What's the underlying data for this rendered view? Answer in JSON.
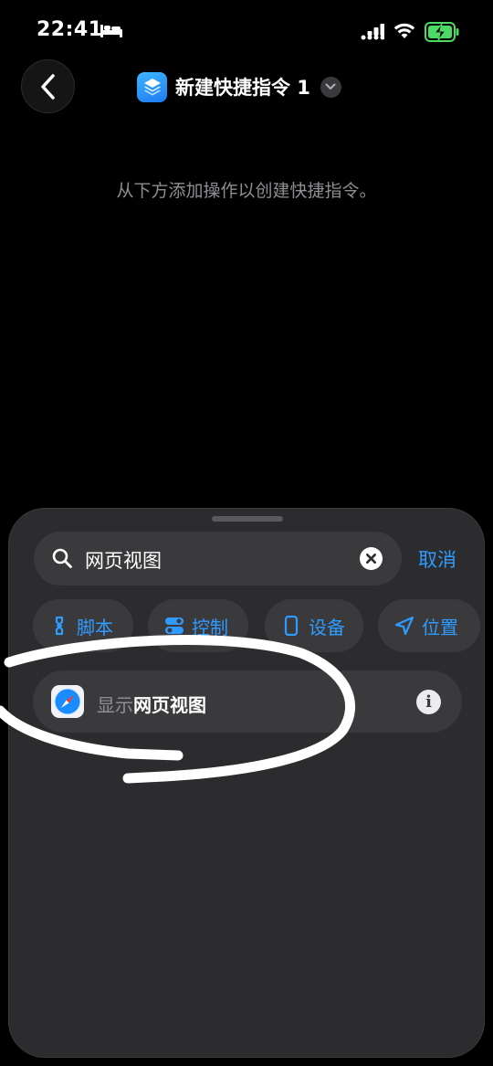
{
  "status_bar": {
    "time": "22:41",
    "icons": [
      "bed-icon",
      "signal-icon",
      "wifi-icon",
      "battery-charging-icon"
    ],
    "battery_color": "#4cd964"
  },
  "header": {
    "title": "新建快捷指令 1",
    "back_icon": "chevron-left-icon",
    "app_icon": "shortcuts-icon",
    "dropdown_icon": "chevron-down-icon"
  },
  "empty_hint": "从下方添加操作以创建快捷指令。",
  "sheet": {
    "search": {
      "value": "网页视图",
      "icon": "search-icon",
      "clear_icon": "clear-icon"
    },
    "cancel_label": "取消",
    "chips": [
      {
        "label": "脚本",
        "icon": "script-icon"
      },
      {
        "label": "控制",
        "icon": "toggle-icon"
      },
      {
        "label": "设备",
        "icon": "phone-icon"
      },
      {
        "label": "位置",
        "icon": "location-arrow-icon"
      }
    ],
    "results": [
      {
        "prefix": "显示",
        "match": "网页视图",
        "icon": "safari-icon",
        "info": "i"
      }
    ]
  },
  "colors": {
    "accent": "#2f9bff",
    "sheet_bg": "#2c2c2e",
    "field_bg": "#3a3a3c",
    "secondary_text": "#8e8e93"
  }
}
